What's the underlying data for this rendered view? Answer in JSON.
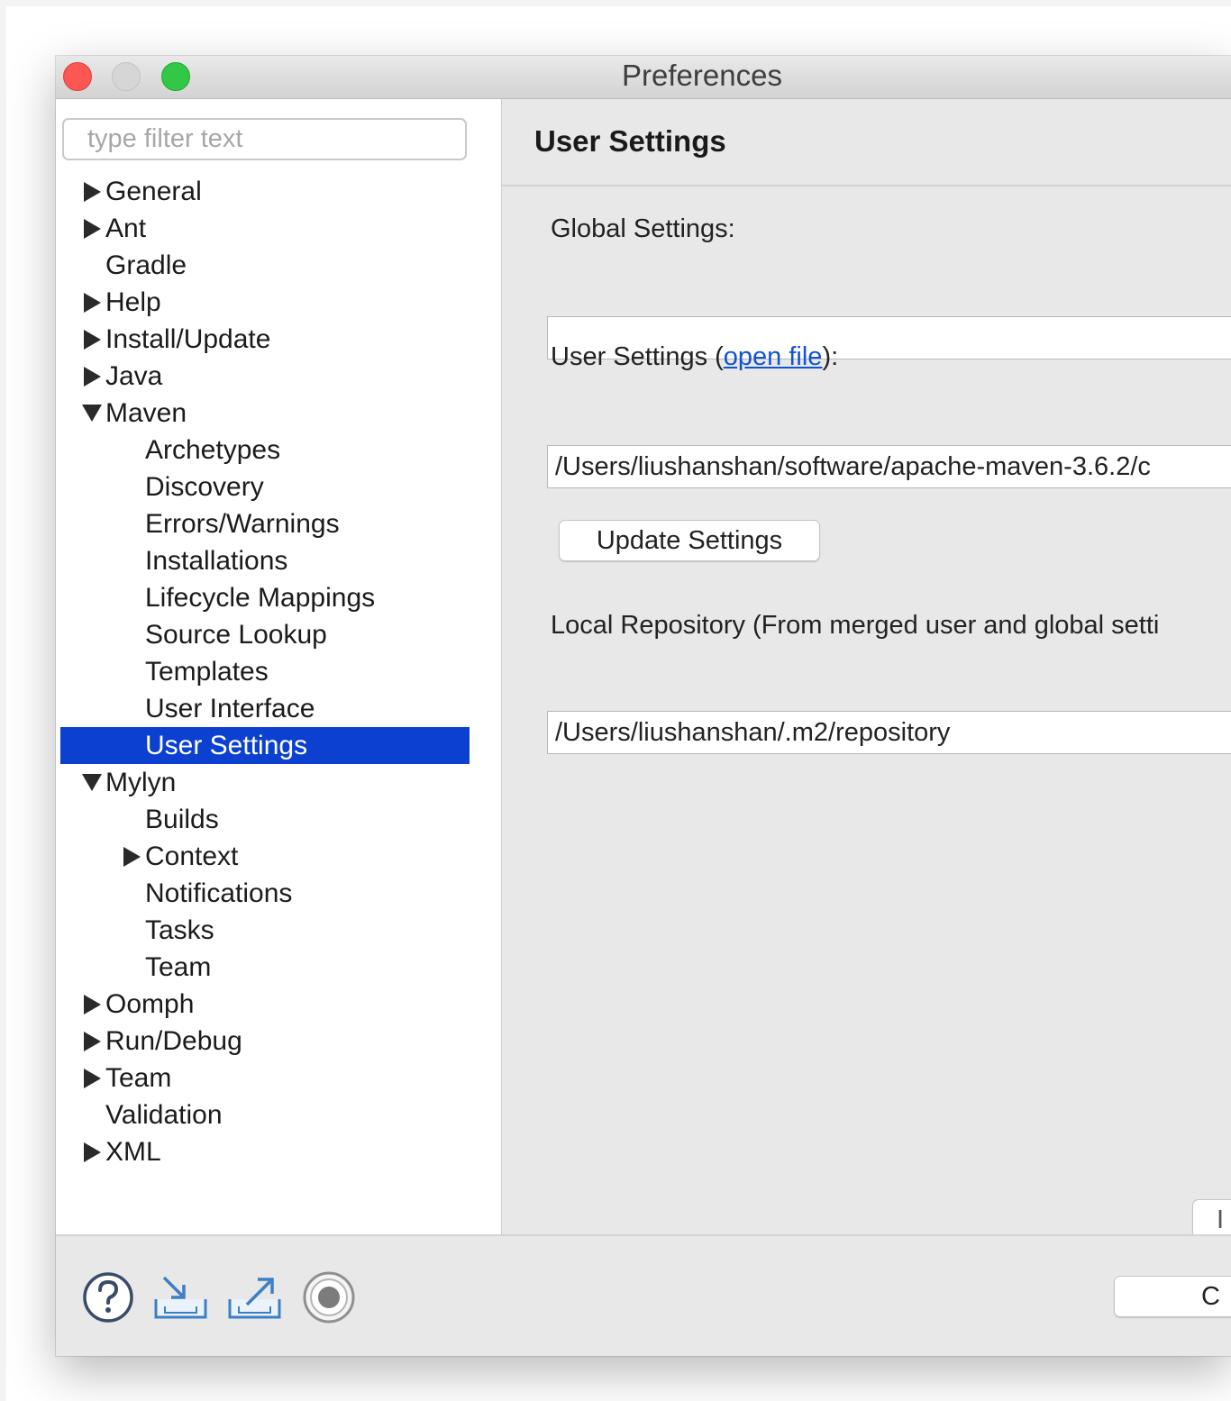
{
  "window": {
    "title": "Preferences"
  },
  "sidebar": {
    "filter_placeholder": "type filter text",
    "items": [
      {
        "label": "General",
        "level": 0,
        "expander": "right"
      },
      {
        "label": "Ant",
        "level": 0,
        "expander": "right"
      },
      {
        "label": "Gradle",
        "level": 0,
        "expander": "none"
      },
      {
        "label": "Help",
        "level": 0,
        "expander": "right"
      },
      {
        "label": "Install/Update",
        "level": 0,
        "expander": "right"
      },
      {
        "label": "Java",
        "level": 0,
        "expander": "right"
      },
      {
        "label": "Maven",
        "level": 0,
        "expander": "down"
      },
      {
        "label": "Archetypes",
        "level": 1,
        "expander": "none"
      },
      {
        "label": "Discovery",
        "level": 1,
        "expander": "none"
      },
      {
        "label": "Errors/Warnings",
        "level": 1,
        "expander": "none"
      },
      {
        "label": "Installations",
        "level": 1,
        "expander": "none"
      },
      {
        "label": "Lifecycle Mappings",
        "level": 1,
        "expander": "none"
      },
      {
        "label": "Source Lookup",
        "level": 1,
        "expander": "none"
      },
      {
        "label": "Templates",
        "level": 1,
        "expander": "none"
      },
      {
        "label": "User Interface",
        "level": 1,
        "expander": "none"
      },
      {
        "label": "User Settings",
        "level": 1,
        "expander": "none",
        "selected": true
      },
      {
        "label": "Mylyn",
        "level": 0,
        "expander": "down"
      },
      {
        "label": "Builds",
        "level": 1,
        "expander": "none"
      },
      {
        "label": "Context",
        "level": 1,
        "expander": "right"
      },
      {
        "label": "Notifications",
        "level": 1,
        "expander": "none"
      },
      {
        "label": "Tasks",
        "level": 1,
        "expander": "none"
      },
      {
        "label": "Team",
        "level": 1,
        "expander": "none"
      },
      {
        "label": "Oomph",
        "level": 0,
        "expander": "right"
      },
      {
        "label": "Run/Debug",
        "level": 0,
        "expander": "right"
      },
      {
        "label": "Team",
        "level": 0,
        "expander": "right"
      },
      {
        "label": "Validation",
        "level": 0,
        "expander": "none"
      },
      {
        "label": "XML",
        "level": 0,
        "expander": "right"
      }
    ]
  },
  "main": {
    "page_title": "User Settings",
    "global_settings_label": "Global Settings:",
    "global_settings_value": "",
    "user_settings_prefix": "User Settings (",
    "user_settings_link": "open file",
    "user_settings_suffix": "):",
    "user_settings_value": "/Users/liushanshan/software/apache-maven-3.6.2/c",
    "update_button": "Update Settings",
    "local_repo_label": "Local Repository (From merged user and global setti",
    "local_repo_value": "/Users/liushanshan/.m2/repository",
    "partial_button": "I"
  },
  "footer": {
    "icons": [
      "help-icon",
      "import-icon",
      "export-icon",
      "record-icon"
    ],
    "partial_button": "C"
  },
  "colors": {
    "selection": "#0b40d0",
    "link": "#1053d6",
    "close": "#fc5753",
    "zoom": "#33c748"
  }
}
